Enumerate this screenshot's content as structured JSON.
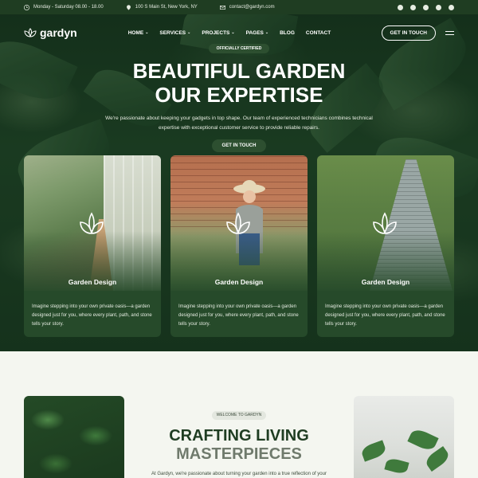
{
  "topbar": {
    "hours": "Monday - Saturday 08.00 - 18.00",
    "address": "100 S Main St, New York, NY",
    "email": "contact@gardyn.com",
    "socials": [
      "facebook-icon",
      "x-icon",
      "youtube-icon",
      "pinterest-icon",
      "instagram-icon"
    ]
  },
  "nav": {
    "logo": "gardyn",
    "items": [
      {
        "label": "HOME",
        "dropdown": true
      },
      {
        "label": "SERVICES",
        "dropdown": true
      },
      {
        "label": "PROJECTS",
        "dropdown": true
      },
      {
        "label": "PAGES",
        "dropdown": true
      },
      {
        "label": "BLOG",
        "dropdown": false
      },
      {
        "label": "CONTACT",
        "dropdown": false
      }
    ],
    "cta": "GET IN TOUCH"
  },
  "hero": {
    "badge": "OFFICIALLY CERTIFIED",
    "title_line1": "BEAUTIFUL GARDEN",
    "title_line2": "OUR EXPERTISE",
    "text": "We're passionate about keeping your gadgets in top shape. Our team of experienced technicians combines technical expertise with exceptional customer service to provide reliable repairs.",
    "button": "GET IN TOUCH"
  },
  "cards": [
    {
      "title": "Garden Design",
      "text": "Imagine stepping into your own private oasis—a garden designed just for you, where every plant, path, and stone tells your story."
    },
    {
      "title": "Garden Design",
      "text": "Imagine stepping into your own private oasis—a garden designed just for you, where every plant, path, and stone tells your story."
    },
    {
      "title": "Garden Design",
      "text": "Imagine stepping into your own private oasis—a garden designed just for you, where every plant, path, and stone tells your story."
    }
  ],
  "welcome": {
    "badge": "WELCOME TO GARDYN",
    "title_line1": "CRAFTING LIVING",
    "title_line2": "MASTERPIECES",
    "text": "At Gardyn, we're passionate about turning your garden into a true reflection of your"
  },
  "colors": {
    "primary": "#1f3d22",
    "card": "#264a2a",
    "muted_title": "#6f7a6c",
    "background": "#f4f6f0"
  }
}
